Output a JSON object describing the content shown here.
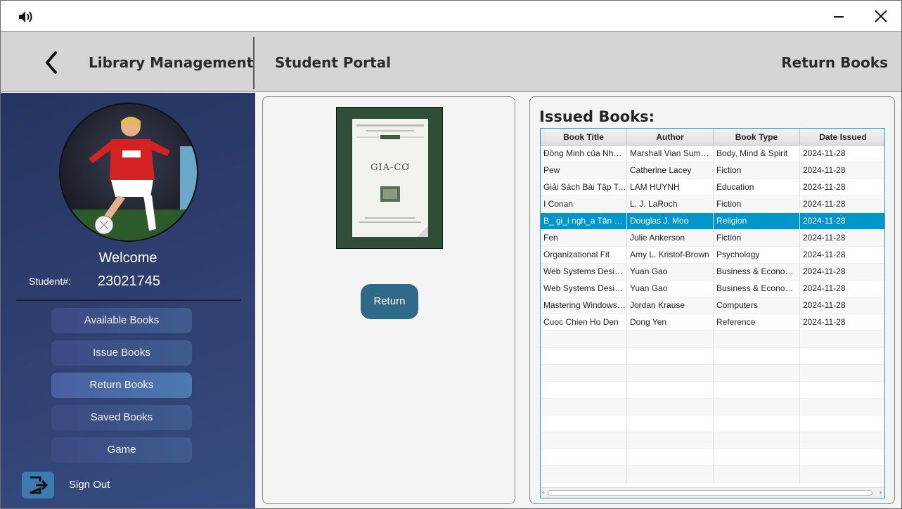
{
  "titlebar": {
    "speaker_icon": "speaker-volume-icon",
    "minimize_icon": "minimize-icon",
    "close_icon": "close-icon"
  },
  "header": {
    "app_title": "Library Management",
    "portal_title": "Student Portal",
    "page_title": "Return Books",
    "back_icon": "chevron-left-icon"
  },
  "sidebar": {
    "welcome": "Welcome",
    "student_label": "Student#:",
    "student_number": "23021745",
    "nav": [
      {
        "label": "Available Books",
        "active": false
      },
      {
        "label": "Issue Books",
        "active": false
      },
      {
        "label": "Return Books",
        "active": true
      },
      {
        "label": "Saved Books",
        "active": false
      },
      {
        "label": "Game",
        "active": false
      }
    ],
    "signout_label": "Sign Out",
    "signout_icon": "sign-out-icon"
  },
  "book_preview": {
    "cover_title": "GIA-CƠ",
    "return_button": "Return"
  },
  "issued": {
    "title": "Issued Books:",
    "columns": [
      "Book Title",
      "Author",
      "Book Type",
      "Date Issued"
    ],
    "selected_index": 4,
    "rows": [
      [
        "Đồng Minh của Nhâ…",
        "Marshall Vian Sum…",
        "Body, Mind & Spirit",
        "2024-11-28"
      ],
      [
        "Pew",
        "Catherine Lacey",
        "Fiction",
        "2024-11-28"
      ],
      [
        "Giải Sách Bài Tập To…",
        "LAM HUYNH",
        "Education",
        "2024-11-28"
      ],
      [
        "I Conan",
        "L. J. LaRoch",
        "Fiction",
        "2024-11-28"
      ],
      [
        "B_ gi_i ngh_a Tân __…",
        "Douglas J. Moo",
        "Religion",
        "2024-11-28"
      ],
      [
        "Fen",
        "Julie Ankerson",
        "Fiction",
        "2024-11-28"
      ],
      [
        "Organizational Fit",
        "Amy L. Kristof-Brown",
        "Psychology",
        "2024-11-28"
      ],
      [
        "Web Systems Desig…",
        "Yuan Gao",
        "Business & Economi…",
        "2024-11-28"
      ],
      [
        "Web Systems Desig…",
        "Yuan Gao",
        "Business & Economi…",
        "2024-11-28"
      ],
      [
        "Mastering Windows…",
        "Jordan Krause",
        "Computers",
        "2024-11-28"
      ],
      [
        "Cuoc Chien Ho Den",
        "Dong Yen",
        "Reference",
        "2024-11-28"
      ]
    ],
    "empty_rows": 9
  }
}
